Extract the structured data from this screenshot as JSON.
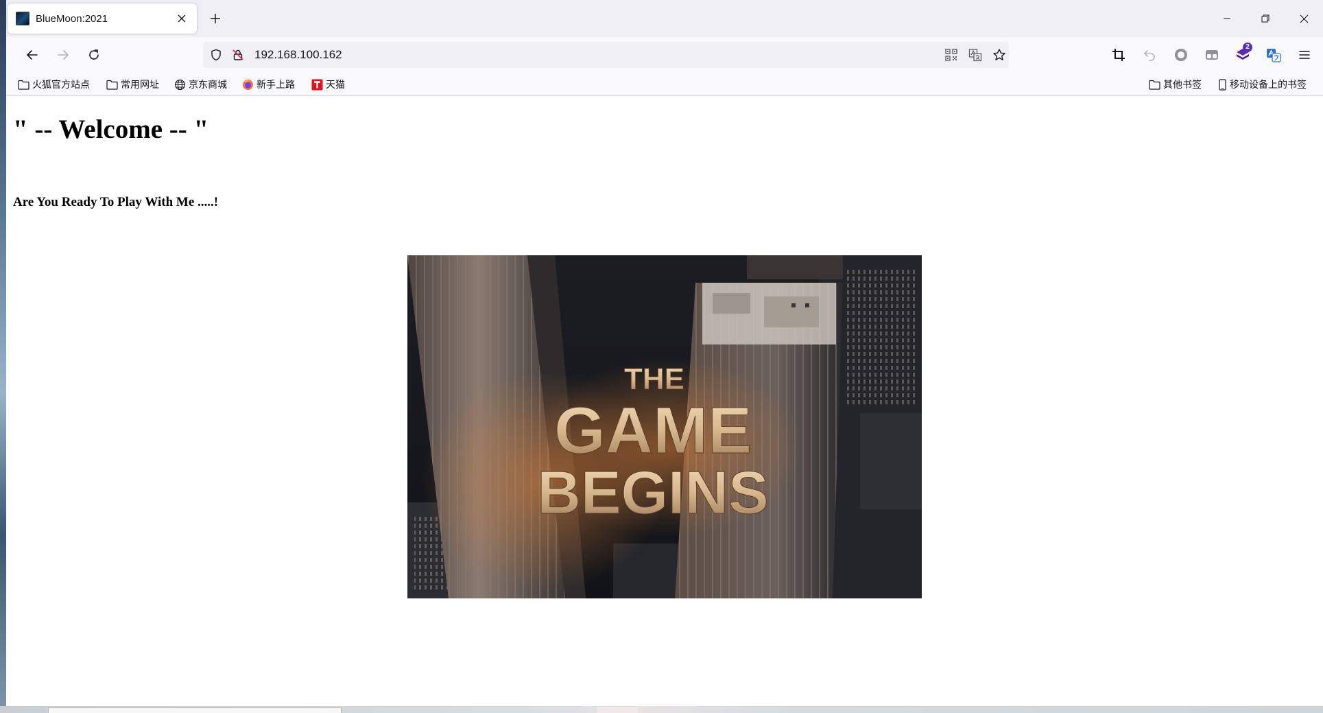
{
  "window": {
    "tab_title": "BlueMoon:2021"
  },
  "toolbar": {
    "url": "192.168.100.162",
    "extension_badge": "2"
  },
  "bookmarks": {
    "left": [
      {
        "label": "火狐官方站点",
        "icon": "folder-icon"
      },
      {
        "label": "常用网址",
        "icon": "folder-icon"
      },
      {
        "label": "京东商城",
        "icon": "globe-icon"
      },
      {
        "label": "新手上路",
        "icon": "firefox-icon"
      },
      {
        "label": "天猫",
        "icon": "tmall-icon"
      }
    ],
    "right": [
      {
        "label": "其他书签",
        "icon": "folder-icon"
      },
      {
        "label": "移动设备上的书签",
        "icon": "mobile-icon"
      }
    ]
  },
  "page": {
    "heading": "\" -- Welcome -- \"",
    "subheading": "Are You Ready To Play With Me .....!",
    "image": {
      "line1": "THE",
      "line2": "GAME",
      "line3": "BEGINS"
    }
  },
  "colors": {
    "tab_strip": "#f0f0f4",
    "toolbar": "#f9f9fb",
    "accent_purple": "#5b2db8",
    "title_gold": "#d8b78e"
  }
}
